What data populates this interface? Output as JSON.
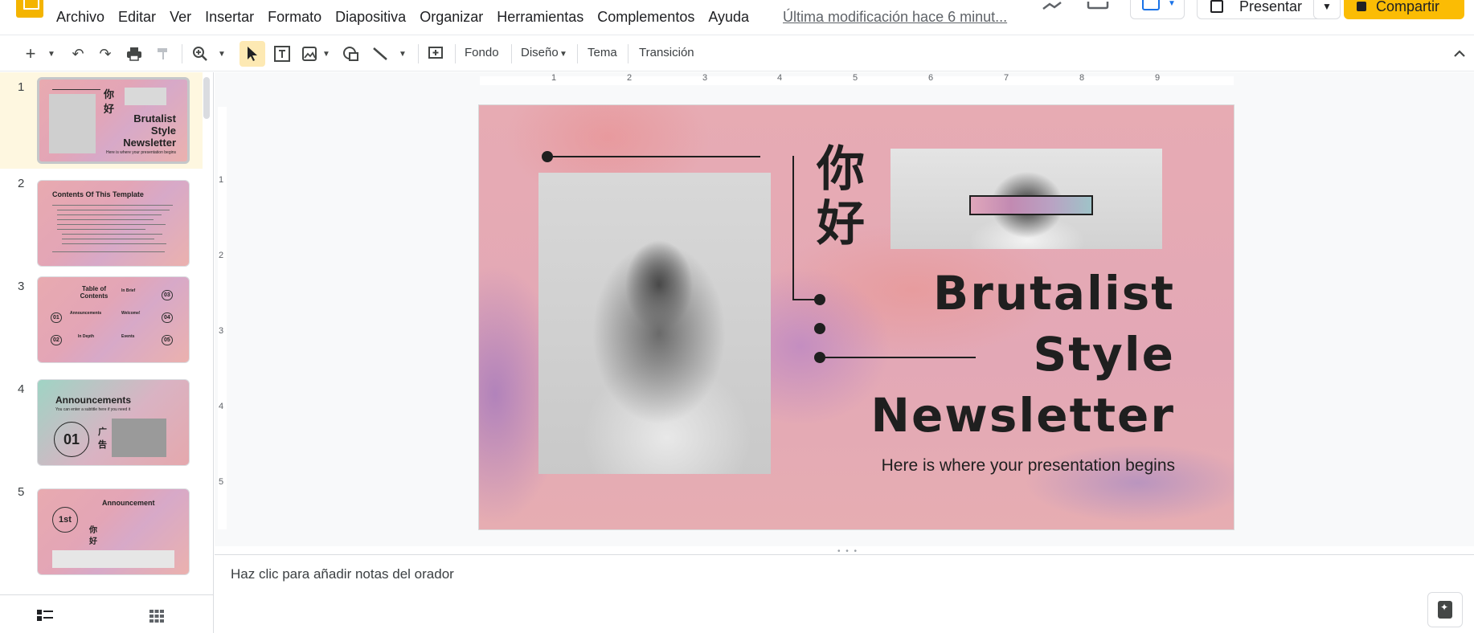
{
  "menu": {
    "items": [
      "Archivo",
      "Editar",
      "Ver",
      "Insertar",
      "Formato",
      "Diapositiva",
      "Organizar",
      "Herramientas",
      "Complementos",
      "Ayuda"
    ],
    "last_modified": "Última modificación hace 6 minut..."
  },
  "header": {
    "present_label": "Presentar",
    "share_label": "Compartir"
  },
  "toolbar": {
    "background_label": "Fondo",
    "layout_label": "Diseño",
    "theme_label": "Tema",
    "transition_label": "Transición"
  },
  "filmstrip": {
    "slides": [
      {
        "number": "1",
        "title_lines": [
          "Brutalist",
          "Style",
          "Newsletter"
        ],
        "hanzi": [
          "你",
          "好"
        ],
        "subtitle": "Here is where your presentation begins"
      },
      {
        "number": "2",
        "title": "Contents Of This Template"
      },
      {
        "number": "3",
        "title": "Table of Contents",
        "items": [
          "01",
          "02",
          "03",
          "04",
          "05"
        ],
        "labels": [
          "Announcements",
          "In Depth",
          "In Brief",
          "Welcome!",
          "Events"
        ]
      },
      {
        "number": "4",
        "title": "Announcements",
        "subtitle": "You can enter a subtitle here if you need it",
        "badge": "01",
        "hanzi": [
          "广",
          "告"
        ]
      },
      {
        "number": "5",
        "title": "Announcement",
        "badge": "1st",
        "hanzi": [
          "你",
          "好"
        ]
      }
    ]
  },
  "ruler": {
    "h_numbers": [
      "1",
      "2",
      "3",
      "4",
      "5",
      "6",
      "7",
      "8",
      "9"
    ],
    "v_numbers": [
      "1",
      "2",
      "3",
      "4",
      "5"
    ]
  },
  "slide": {
    "hanzi": [
      "你",
      "好"
    ],
    "title_lines": [
      "Brutalist",
      "Style",
      "Newsletter"
    ],
    "subtitle": "Here is where your presentation begins"
  },
  "notes": {
    "placeholder": "Haz clic para añadir notas del orador"
  },
  "colors": {
    "accent_yellow": "#fbbc04",
    "selection_bg": "#fef7e0",
    "slide_pink": "#e7abb3",
    "text_dark": "#1f1f1f"
  }
}
